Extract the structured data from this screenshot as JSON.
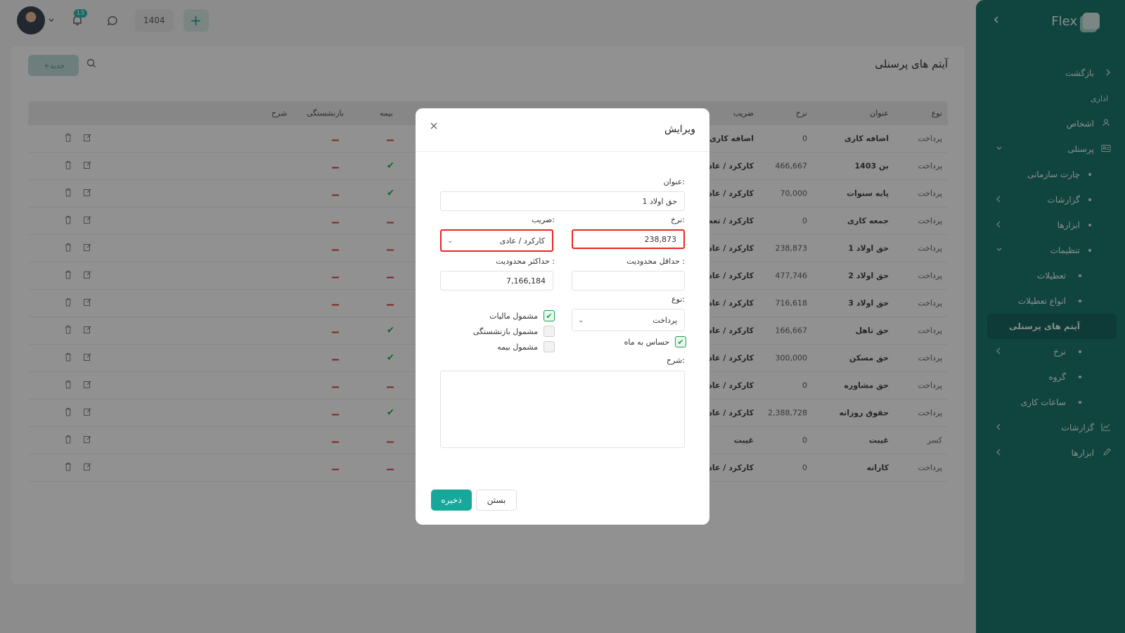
{
  "topbar": {
    "notification_count": "13",
    "year": "1404"
  },
  "page": {
    "title": "آیتم های پرسنلی",
    "new_button": "جدید"
  },
  "table": {
    "headers": {
      "type": "نوع",
      "title": "عنوان",
      "rate": "نرخ",
      "coef": "ضریب",
      "insurance": "بیمه",
      "retirement": "بازنشستگی",
      "description": "شرح"
    },
    "rows": [
      {
        "type": "پرداخت",
        "title": "اضافه کاری",
        "rate": "0",
        "coef": "اضافه کاری",
        "insurance": false,
        "retirement": false
      },
      {
        "type": "پرداخت",
        "title": "بن 1403",
        "rate": "466,667",
        "coef": "کارکرد / عادی",
        "insurance": true,
        "retirement": false
      },
      {
        "type": "پرداخت",
        "title": "پایه سنوات",
        "rate": "70,000",
        "coef": "کارکرد / عادی",
        "insurance": true,
        "retirement": false
      },
      {
        "type": "پرداخت",
        "title": "جمعه کاری",
        "rate": "0",
        "coef": "کارکرد / تعطیل",
        "insurance": false,
        "retirement": false
      },
      {
        "type": "پرداخت",
        "title": "حق اولاد 1",
        "rate": "238,873",
        "coef": "کارکرد / عادی",
        "insurance": false,
        "retirement": false
      },
      {
        "type": "پرداخت",
        "title": "حق اولاد 2",
        "rate": "477,746",
        "coef": "کارکرد / عادی",
        "insurance": false,
        "retirement": false
      },
      {
        "type": "پرداخت",
        "title": "حق اولاد 3",
        "rate": "716,618",
        "coef": "کارکرد / عادی",
        "insurance": false,
        "retirement": false
      },
      {
        "type": "پرداخت",
        "title": "حق تاهل",
        "rate": "166,667",
        "coef": "کارکرد / عادی",
        "insurance": true,
        "retirement": false
      },
      {
        "type": "پرداخت",
        "title": "حق مسکن",
        "rate": "300,000",
        "coef": "کارکرد / عادی",
        "insurance": true,
        "retirement": false
      },
      {
        "type": "پرداخت",
        "title": "حق مشاوره",
        "rate": "0",
        "coef": "کارکرد / عادی",
        "insurance": false,
        "retirement": false
      },
      {
        "type": "پرداخت",
        "title": "حقوق روزانه",
        "rate": "2,388,728",
        "coef": "کارکرد / عادی",
        "insurance": true,
        "retirement": false
      },
      {
        "type": "کسر",
        "title": "غیبت",
        "rate": "0",
        "coef": "غیبت",
        "insurance": false,
        "retirement": false
      },
      {
        "type": "پرداخت",
        "title": "کارانه",
        "rate": "0",
        "coef": "کارکرد / عادی",
        "insurance": false,
        "retirement": false
      }
    ]
  },
  "sidebar": {
    "brand": "Flex",
    "items": [
      {
        "label": "بازگشت",
        "kind": "back"
      },
      {
        "label": "اداری",
        "kind": "section"
      },
      {
        "label": "اشخاص",
        "kind": "top",
        "icon": "users-icon"
      },
      {
        "label": "پرسنلی",
        "kind": "top",
        "icon": "id-card-icon",
        "chevron": "down"
      },
      {
        "label": "چارت سازمانی",
        "kind": "sub"
      },
      {
        "label": "گزارشات",
        "kind": "sub",
        "chevron": "left"
      },
      {
        "label": "ابزارها",
        "kind": "sub",
        "chevron": "left"
      },
      {
        "label": "تنظیمات",
        "kind": "sub",
        "chevron": "down"
      },
      {
        "label": "تعطیلات",
        "kind": "sub2"
      },
      {
        "label": "انواع تعطیلات",
        "kind": "sub2"
      },
      {
        "label": "آیتم های پرسنلی",
        "kind": "active"
      },
      {
        "label": "نرخ",
        "kind": "sub2",
        "chevron": "left"
      },
      {
        "label": "گروه",
        "kind": "sub2"
      },
      {
        "label": "ساعات کاری",
        "kind": "sub2"
      },
      {
        "label": "گزارشات",
        "kind": "top",
        "icon": "chart-icon",
        "chevron": "left"
      },
      {
        "label": "ابزارها",
        "kind": "top",
        "icon": "pencil-icon",
        "chevron": "left"
      }
    ]
  },
  "modal": {
    "title": "ویرایش",
    "title_label": "عنوان:",
    "title_value": "حق اولاد 1",
    "rate_label": "نرخ:",
    "rate_value": "238,873",
    "coef_label": "ضریب:",
    "coef_value": "کارکرد / عادی",
    "min_label": "حداقل محدودیت :",
    "min_value": "",
    "max_label": "حداکثر محدودیت :",
    "max_value": "7,166,184",
    "type_label": "نوع:",
    "type_value": "پرداخت",
    "tax_label": "مشمول مالیات",
    "retirement_label": "مشمول بازنشستگی",
    "insurance_label": "مشمول بیمه",
    "month_sensitive_label": "حساس به ماه",
    "desc_label": "شرح:",
    "save_button": "ذخیره",
    "close_button": "بستن",
    "checks": {
      "tax": true,
      "retirement": false,
      "insurance": false,
      "month_sensitive": true
    }
  }
}
